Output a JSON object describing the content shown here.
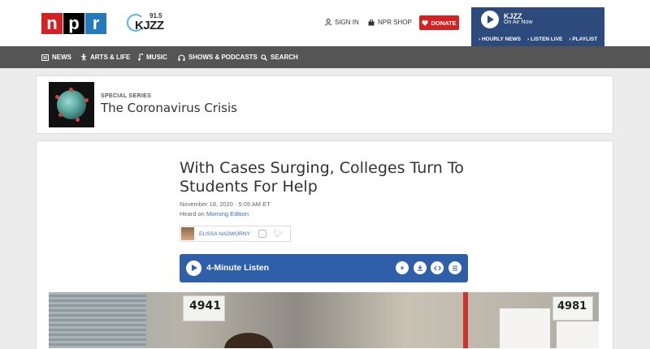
{
  "header": {
    "npr_logo": [
      "n",
      "p",
      "r"
    ],
    "station_logo": {
      "frequency": "91.5",
      "name": "KJZZ"
    },
    "sign_in": "SIGN IN",
    "shop": "NPR SHOP",
    "donate": "DONATE",
    "station": {
      "name": "KJZZ",
      "status": "On Air Now",
      "links": [
        "HOURLY NEWS",
        "LISTEN LIVE",
        "PLAYLIST"
      ]
    }
  },
  "nav": {
    "items": [
      {
        "label": "NEWS",
        "icon": "news-icon"
      },
      {
        "label": "ARTS & LIFE",
        "icon": "arts-icon"
      },
      {
        "label": "MUSIC",
        "icon": "music-note-icon"
      },
      {
        "label": "SHOWS & PODCASTS",
        "icon": "headphones-icon"
      },
      {
        "label": "SEARCH",
        "icon": "search-icon"
      }
    ]
  },
  "series": {
    "label": "SPECIAL SERIES",
    "title": "The Coronavirus Crisis"
  },
  "article": {
    "headline": "With Cases Surging, Colleges Turn To Students For Help",
    "date": "November 18, 2020 · 5:05 AM ET",
    "heard_on_prefix": "Heard on",
    "heard_on_show": "Morning Edition",
    "author": "ELISSA NADWORNY",
    "listen_label": "4-Minute Listen",
    "photo_signs": [
      "4941",
      "4981"
    ]
  },
  "colors": {
    "npr_red": "#d62021",
    "npr_blue": "#237bbd",
    "station_blue": "#2c4a7c",
    "listen_blue": "#2e5fa8",
    "nav_gray": "#555555"
  }
}
